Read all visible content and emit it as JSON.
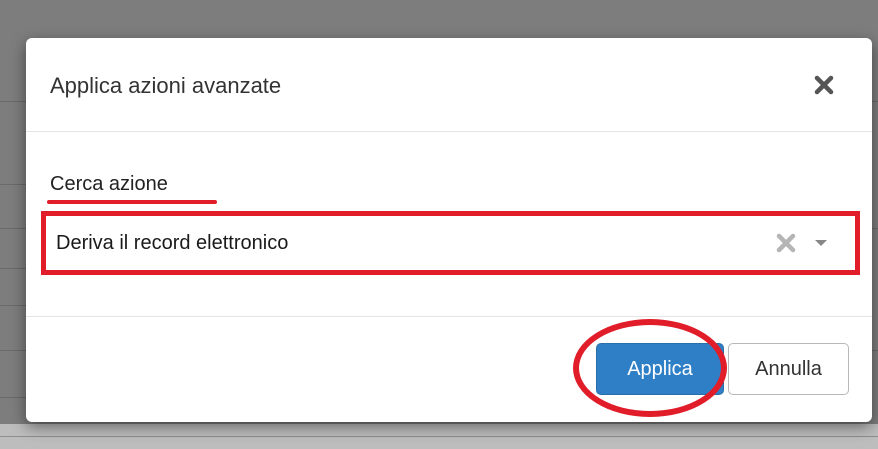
{
  "dialog": {
    "title": "Applica azioni avanzate",
    "close_icon": "close-icon"
  },
  "form": {
    "label": "Cerca azione",
    "select": {
      "value": "Deriva il record elettronico",
      "clear_icon": "clear-icon",
      "caret_icon": "chevron-down-icon"
    }
  },
  "footer": {
    "apply_label": "Applica",
    "cancel_label": "Annulla"
  },
  "colors": {
    "primary": "#2f7fc6",
    "highlight": "#e11d2a",
    "overlay": "#7d7d7d"
  }
}
